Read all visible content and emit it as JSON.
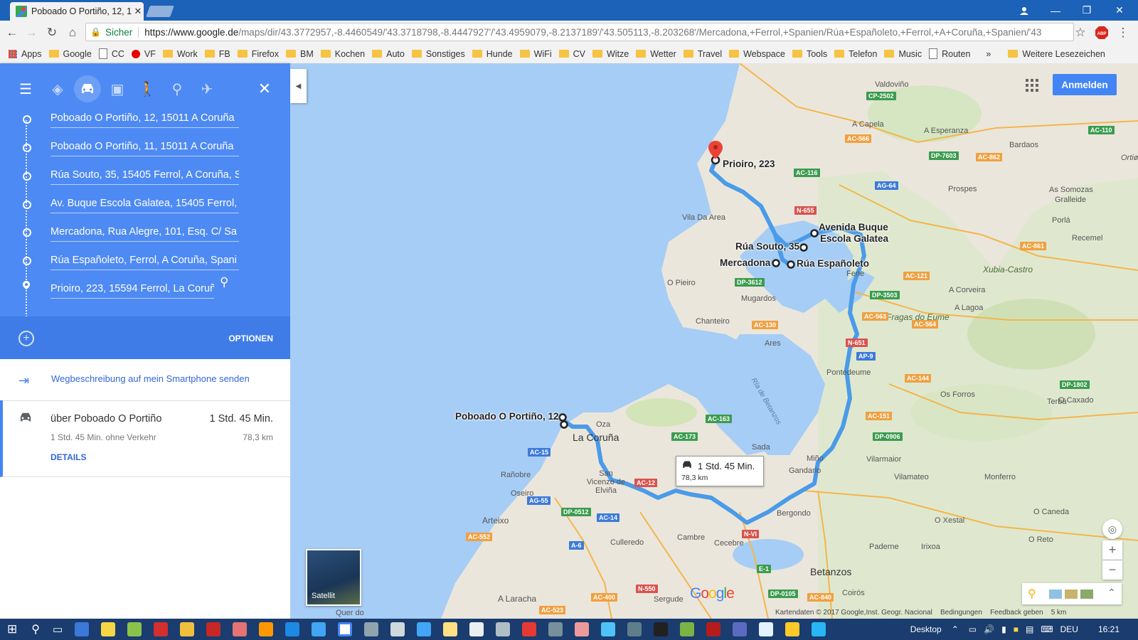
{
  "browser": {
    "tab_title": "Poboado O Portiño, 12, 1",
    "url_secure_label": "Sicher",
    "url_host": "https://www.google.de",
    "url_rest": "/maps/dir/43.3772957,-8.4460549/'43.3718798,-8.4447927'/'43.4959079,-8.2137189'/'43.505113,-8.203268'/Mercadona,+Ferrol,+Spanien/Rúa+Españoleto,+Ferrol,+A+Coruña,+Spanien/'43",
    "bookmarks": [
      {
        "label": "Apps",
        "icon": "apps-grid-icon"
      },
      {
        "label": "Google",
        "icon": "folder-icon"
      },
      {
        "label": "CC",
        "icon": "page-icon"
      },
      {
        "label": "VF",
        "icon": "vodafone-icon"
      },
      {
        "label": "Work",
        "icon": "folder-icon"
      },
      {
        "label": "FB",
        "icon": "folder-icon"
      },
      {
        "label": "Firefox",
        "icon": "folder-icon"
      },
      {
        "label": "BM",
        "icon": "folder-icon"
      },
      {
        "label": "Kochen",
        "icon": "folder-icon"
      },
      {
        "label": "Auto",
        "icon": "folder-icon"
      },
      {
        "label": "Sonstiges",
        "icon": "folder-icon"
      },
      {
        "label": "Hunde",
        "icon": "folder-icon"
      },
      {
        "label": "WiFi",
        "icon": "folder-icon"
      },
      {
        "label": "CV",
        "icon": "folder-icon"
      },
      {
        "label": "Witze",
        "icon": "folder-icon"
      },
      {
        "label": "Wetter",
        "icon": "folder-icon"
      },
      {
        "label": "Travel",
        "icon": "folder-icon"
      },
      {
        "label": "Webspace",
        "icon": "folder-icon"
      },
      {
        "label": "Tools",
        "icon": "folder-icon"
      },
      {
        "label": "Telefon",
        "icon": "folder-icon"
      },
      {
        "label": "Music",
        "icon": "folder-icon"
      },
      {
        "label": "Routen",
        "icon": "page-icon"
      }
    ],
    "bookmarks_overflow": "»",
    "other_bookmarks": "Weitere Lesezeichen"
  },
  "directions": {
    "waypoints": [
      "Poboado O Portiño, 12, 15011 A Coruña",
      "Poboado O Portiño, 11, 15011 A Coruña",
      "Rúa Souto, 35, 15405 Ferrol, A Coruña, S",
      "Av. Buque Escola Galatea, 15405 Ferrol,",
      "Mercadona, Rua Alegre, 101, Esq. C/ Sa",
      "Rúa Españoleto, Ferrol, A Coruña, Spani",
      "Prioiro, 223, 15594 Ferrol, La Coruñ"
    ],
    "options_label": "OPTIONEN",
    "send_label": "Wegbeschreibung auf mein Smartphone senden",
    "route": {
      "name": "über Poboado O Portiño",
      "time": "1 Std. 45 Min.",
      "subtext": "1 Std. 45 Min. ohne Verkehr",
      "distance": "78,3 km",
      "details_label": "DETAILS"
    }
  },
  "map": {
    "signin_label": "Anmelden",
    "bubble_time": "1 Std. 45 Min.",
    "bubble_distance": "78,3 km",
    "satellite_label": "Satellit",
    "google_logo": "Google",
    "footer": [
      "Kartendaten © 2017 Google,Inst. Geogr. Nacional",
      "Bedingungen",
      "Feedback geben",
      "5 km"
    ],
    "waypoint_labels": [
      "Prioiro, 223",
      "Avenida Buque",
      "Escola Galatea",
      "Rúa Souto, 35",
      "Mercadona",
      "Rúa Españoleto",
      "Poboado O Portiño, 12"
    ],
    "cities": [
      "La Coruña",
      "Betanzos"
    ],
    "places": [
      "Valdoviño",
      "A Capela",
      "A Esperanza",
      "Bardaos",
      "Prospes",
      "As Somozas",
      "Gralleide",
      "Porlá",
      "Recemel",
      "Xubia-Castro",
      "A Corveira",
      "A Lagoa",
      "Vila Da Area",
      "O Pieiro",
      "Mugardos",
      "Chanteiro",
      "Ares",
      "Fene",
      "Fragas do Eume",
      "Pontedeume",
      "Os Forros",
      "Terbá",
      "O Caxado",
      "Oza",
      "Sada",
      "Gandario",
      "Miño",
      "Vilarmaior",
      "Vilamateo",
      "Monferro",
      "Ría de Betanzos",
      "Rañobre",
      "San Vicenzo de Elviña",
      "Oseiro",
      "Arteixo",
      "Culleredo",
      "Cambre",
      "Cecebre",
      "Bergondo",
      "Paderne",
      "Irixoa",
      "O Xestal",
      "O Caneda",
      "O Reto",
      "A Laracha",
      "Sergude",
      "Coirós",
      "Quer do",
      "Ortiø"
    ],
    "roads": [
      {
        "label": "CP-2502",
        "color": "g"
      },
      {
        "label": "AC-566",
        "color": "o"
      },
      {
        "label": "AC-116",
        "color": "g"
      },
      {
        "label": "N-655",
        "color": "r"
      },
      {
        "label": "AG-64",
        "color": "b"
      },
      {
        "label": "DP-7603",
        "color": "g"
      },
      {
        "label": "AC-862",
        "color": "o"
      },
      {
        "label": "AC-110",
        "color": "g"
      },
      {
        "label": "DP-3612",
        "color": "g"
      },
      {
        "label": "AC-121",
        "color": "o"
      },
      {
        "label": "DP-3503",
        "color": "g"
      },
      {
        "label": "AC-563",
        "color": "o"
      },
      {
        "label": "AC-130",
        "color": "o"
      },
      {
        "label": "N-651",
        "color": "r"
      },
      {
        "label": "AP-9",
        "color": "b"
      },
      {
        "label": "AC-564",
        "color": "o"
      },
      {
        "label": "AC-144",
        "color": "o"
      },
      {
        "label": "DP-1802",
        "color": "g"
      },
      {
        "label": "AC-163",
        "color": "g"
      },
      {
        "label": "AC-173",
        "color": "g"
      },
      {
        "label": "AC-151",
        "color": "o"
      },
      {
        "label": "DP-0906",
        "color": "g"
      },
      {
        "label": "AC-15",
        "color": "b"
      },
      {
        "label": "AC-12",
        "color": "r"
      },
      {
        "label": "AG-55",
        "color": "b"
      },
      {
        "label": "DP-0512",
        "color": "g"
      },
      {
        "label": "AC-14",
        "color": "b"
      },
      {
        "label": "AC-552",
        "color": "o"
      },
      {
        "label": "A-6",
        "color": "b"
      },
      {
        "label": "N-VI",
        "color": "r"
      },
      {
        "label": "AC-400",
        "color": "o"
      },
      {
        "label": "N-550",
        "color": "r"
      },
      {
        "label": "AC-523",
        "color": "o"
      },
      {
        "label": "E-1",
        "color": "g"
      },
      {
        "label": "DP-0105",
        "color": "g"
      },
      {
        "label": "AC-840",
        "color": "o"
      },
      {
        "label": "AC-861",
        "color": "o"
      }
    ]
  },
  "taskbar": {
    "desktop_label": "Desktop",
    "lang": "DEU",
    "time": "16:21"
  },
  "colors": {
    "panel_blue": "#4e8af4",
    "route_blue": "#4a9be8",
    "water": "#a6cdf6",
    "land": "#e9e6df"
  }
}
